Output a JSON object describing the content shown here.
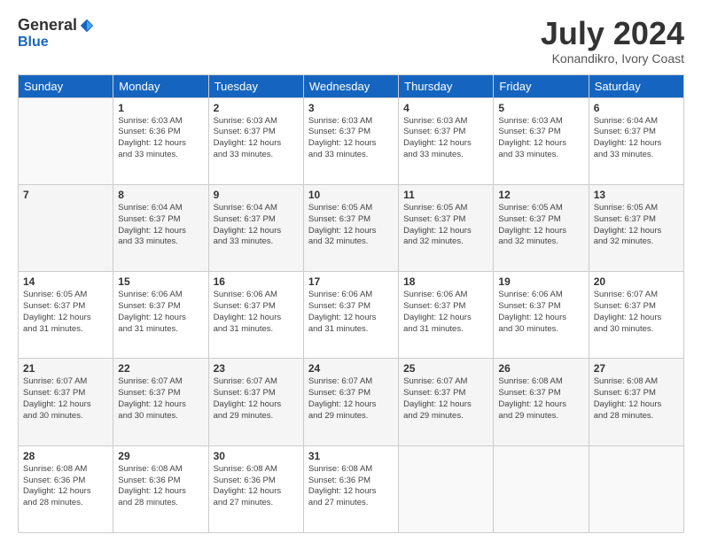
{
  "header": {
    "logo_general": "General",
    "logo_blue": "Blue",
    "title": "July 2024",
    "subtitle": "Konandikro, Ivory Coast"
  },
  "columns": [
    "Sunday",
    "Monday",
    "Tuesday",
    "Wednesday",
    "Thursday",
    "Friday",
    "Saturday"
  ],
  "weeks": [
    [
      {
        "day": "",
        "info": ""
      },
      {
        "day": "1",
        "info": "Sunrise: 6:03 AM\nSunset: 6:36 PM\nDaylight: 12 hours\nand 33 minutes."
      },
      {
        "day": "2",
        "info": "Sunrise: 6:03 AM\nSunset: 6:37 PM\nDaylight: 12 hours\nand 33 minutes."
      },
      {
        "day": "3",
        "info": "Sunrise: 6:03 AM\nSunset: 6:37 PM\nDaylight: 12 hours\nand 33 minutes."
      },
      {
        "day": "4",
        "info": "Sunrise: 6:03 AM\nSunset: 6:37 PM\nDaylight: 12 hours\nand 33 minutes."
      },
      {
        "day": "5",
        "info": "Sunrise: 6:03 AM\nSunset: 6:37 PM\nDaylight: 12 hours\nand 33 minutes."
      },
      {
        "day": "6",
        "info": "Sunrise: 6:04 AM\nSunset: 6:37 PM\nDaylight: 12 hours\nand 33 minutes."
      }
    ],
    [
      {
        "day": "7",
        "info": ""
      },
      {
        "day": "8",
        "info": "Sunrise: 6:04 AM\nSunset: 6:37 PM\nDaylight: 12 hours\nand 33 minutes."
      },
      {
        "day": "9",
        "info": "Sunrise: 6:04 AM\nSunset: 6:37 PM\nDaylight: 12 hours\nand 33 minutes."
      },
      {
        "day": "10",
        "info": "Sunrise: 6:05 AM\nSunset: 6:37 PM\nDaylight: 12 hours\nand 32 minutes."
      },
      {
        "day": "11",
        "info": "Sunrise: 6:05 AM\nSunset: 6:37 PM\nDaylight: 12 hours\nand 32 minutes."
      },
      {
        "day": "12",
        "info": "Sunrise: 6:05 AM\nSunset: 6:37 PM\nDaylight: 12 hours\nand 32 minutes."
      },
      {
        "day": "13",
        "info": "Sunrise: 6:05 AM\nSunset: 6:37 PM\nDaylight: 12 hours\nand 32 minutes."
      }
    ],
    [
      {
        "day": "14",
        "info": "Sunrise: 6:05 AM\nSunset: 6:37 PM\nDaylight: 12 hours\nand 31 minutes."
      },
      {
        "day": "15",
        "info": "Sunrise: 6:06 AM\nSunset: 6:37 PM\nDaylight: 12 hours\nand 31 minutes."
      },
      {
        "day": "16",
        "info": "Sunrise: 6:06 AM\nSunset: 6:37 PM\nDaylight: 12 hours\nand 31 minutes."
      },
      {
        "day": "17",
        "info": "Sunrise: 6:06 AM\nSunset: 6:37 PM\nDaylight: 12 hours\nand 31 minutes."
      },
      {
        "day": "18",
        "info": "Sunrise: 6:06 AM\nSunset: 6:37 PM\nDaylight: 12 hours\nand 31 minutes."
      },
      {
        "day": "19",
        "info": "Sunrise: 6:06 AM\nSunset: 6:37 PM\nDaylight: 12 hours\nand 30 minutes."
      },
      {
        "day": "20",
        "info": "Sunrise: 6:07 AM\nSunset: 6:37 PM\nDaylight: 12 hours\nand 30 minutes."
      }
    ],
    [
      {
        "day": "21",
        "info": "Sunrise: 6:07 AM\nSunset: 6:37 PM\nDaylight: 12 hours\nand 30 minutes."
      },
      {
        "day": "22",
        "info": "Sunrise: 6:07 AM\nSunset: 6:37 PM\nDaylight: 12 hours\nand 30 minutes."
      },
      {
        "day": "23",
        "info": "Sunrise: 6:07 AM\nSunset: 6:37 PM\nDaylight: 12 hours\nand 29 minutes."
      },
      {
        "day": "24",
        "info": "Sunrise: 6:07 AM\nSunset: 6:37 PM\nDaylight: 12 hours\nand 29 minutes."
      },
      {
        "day": "25",
        "info": "Sunrise: 6:07 AM\nSunset: 6:37 PM\nDaylight: 12 hours\nand 29 minutes."
      },
      {
        "day": "26",
        "info": "Sunrise: 6:08 AM\nSunset: 6:37 PM\nDaylight: 12 hours\nand 29 minutes."
      },
      {
        "day": "27",
        "info": "Sunrise: 6:08 AM\nSunset: 6:37 PM\nDaylight: 12 hours\nand 28 minutes."
      }
    ],
    [
      {
        "day": "28",
        "info": "Sunrise: 6:08 AM\nSunset: 6:36 PM\nDaylight: 12 hours\nand 28 minutes."
      },
      {
        "day": "29",
        "info": "Sunrise: 6:08 AM\nSunset: 6:36 PM\nDaylight: 12 hours\nand 28 minutes."
      },
      {
        "day": "30",
        "info": "Sunrise: 6:08 AM\nSunset: 6:36 PM\nDaylight: 12 hours\nand 27 minutes."
      },
      {
        "day": "31",
        "info": "Sunrise: 6:08 AM\nSunset: 6:36 PM\nDaylight: 12 hours\nand 27 minutes."
      },
      {
        "day": "",
        "info": ""
      },
      {
        "day": "",
        "info": ""
      },
      {
        "day": "",
        "info": ""
      }
    ]
  ]
}
